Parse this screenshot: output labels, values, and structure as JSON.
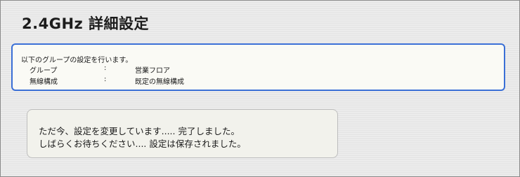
{
  "page": {
    "title": "2.4GHz 詳細設定"
  },
  "info": {
    "intro": "以下のグループの設定を行います。",
    "rows": [
      {
        "label": "グループ",
        "separator": ":",
        "value": "営業フロア"
      },
      {
        "label": "無線構成",
        "separator": ":",
        "value": "既定の無線構成"
      }
    ]
  },
  "status": {
    "line1": "ただ今、設定を変更しています..... 完了しました。",
    "line2": "しばらくお待ちください.... 設定は保存されました。"
  },
  "colors": {
    "info_border": "#3a6fd6",
    "message_border": "#bdbdbd"
  }
}
